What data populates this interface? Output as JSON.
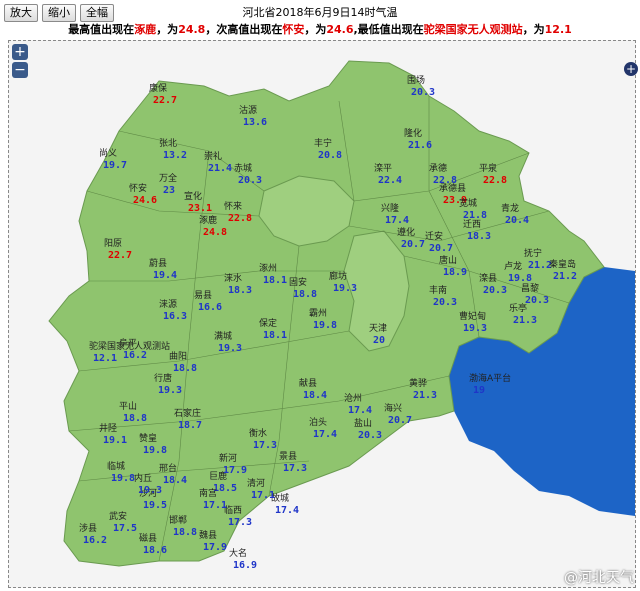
{
  "toolbar": {
    "zoom_in_label": "放大",
    "zoom_out_label": "缩小",
    "full_label": "全幅"
  },
  "title": "河北省2018年6月9日14时气温",
  "subtitle": {
    "p1": "最高值出现在",
    "max_site": "涿鹿",
    "p2": "，为",
    "max_val": "24.8",
    "p3": "，次高值出现在",
    "second_site": "怀安",
    "p4": "，为",
    "second_val": "24.6",
    "p5": ",最低值出现在",
    "min_site": "驼梁国家无人观测站",
    "p6": "，为",
    "min_val": "12.1"
  },
  "map_controls": {
    "zoom_in": "+",
    "zoom_out": "−",
    "side": "+"
  },
  "watermark": "@河北天气",
  "colors": {
    "land": "#8fc46e",
    "sea": "#1d64c6",
    "outside": "#f4f4f4",
    "value": "#1f35c8",
    "hot": "#e00000"
  },
  "stations": [
    {
      "name": "康保",
      "value": "22.7",
      "hot": true
    },
    {
      "name": "沽源",
      "value": "13.6"
    },
    {
      "name": "尚义",
      "value": "19.7"
    },
    {
      "name": "张北",
      "value": "13.2"
    },
    {
      "name": "崇礼",
      "value": "21.4"
    },
    {
      "name": "赤城",
      "value": "20.3"
    },
    {
      "name": "万全",
      "value": "23"
    },
    {
      "name": "宣化",
      "value": "23.1",
      "hot": true
    },
    {
      "name": "怀安",
      "value": "24.6",
      "hot": true
    },
    {
      "name": "涿鹿",
      "value": "24.8",
      "hot": true
    },
    {
      "name": "怀来",
      "value": "22.8",
      "hot": true
    },
    {
      "name": "阳原",
      "value": "22.7",
      "hot": true
    },
    {
      "name": "蔚县",
      "value": "19.4"
    },
    {
      "name": "丰宁",
      "value": "20.8"
    },
    {
      "name": "隆化",
      "value": "21.6"
    },
    {
      "name": "围场",
      "value": "20.3"
    },
    {
      "name": "滦平",
      "value": "22.4"
    },
    {
      "name": "承德",
      "value": "22.8"
    },
    {
      "name": "承德县",
      "value": "23.9",
      "hot": true
    },
    {
      "name": "平泉",
      "value": "22.8",
      "hot": true
    },
    {
      "name": "宽城",
      "value": "21.8"
    },
    {
      "name": "兴隆",
      "value": "17.4"
    },
    {
      "name": "青龙",
      "value": "20.4"
    },
    {
      "name": "迁西",
      "value": "18.3"
    },
    {
      "name": "迁安",
      "value": "20.7"
    },
    {
      "name": "遵化",
      "value": "20.7"
    },
    {
      "name": "抚宁",
      "value": "21.2"
    },
    {
      "name": "秦皇岛",
      "value": "21.2"
    },
    {
      "name": "卢龙",
      "value": "19.8"
    },
    {
      "name": "昌黎",
      "value": "20.3"
    },
    {
      "name": "乐亭",
      "value": "21.3"
    },
    {
      "name": "滦县",
      "value": "20.3"
    },
    {
      "name": "唐山",
      "value": "18.9"
    },
    {
      "name": "丰南",
      "value": "20.3"
    },
    {
      "name": "曹妃甸",
      "value": "19.3"
    },
    {
      "name": "黄骅",
      "value": "21.3"
    },
    {
      "name": "涞源",
      "value": "16.3"
    },
    {
      "name": "易县",
      "value": "16.6"
    },
    {
      "name": "涞水",
      "value": "18.3"
    },
    {
      "name": "涿州",
      "value": "18.1"
    },
    {
      "name": "固安",
      "value": "18.8"
    },
    {
      "name": "廊坊",
      "value": "19.3"
    },
    {
      "name": "霸州",
      "value": "19.8"
    },
    {
      "name": "天津",
      "value": "20"
    },
    {
      "name": "阜平",
      "value": "16.2"
    },
    {
      "name": "曲阳",
      "value": "18.8"
    },
    {
      "name": "保定",
      "value": "18.1"
    },
    {
      "name": "满城",
      "value": "19.3"
    },
    {
      "name": "行唐",
      "value": "19.3"
    },
    {
      "name": "平山",
      "value": "18.8"
    },
    {
      "name": "石家庄",
      "value": "18.7"
    },
    {
      "name": "沧州",
      "value": "17.4"
    },
    {
      "name": "泊头",
      "value": "17.4"
    },
    {
      "name": "献县",
      "value": "18.4"
    },
    {
      "name": "海兴",
      "value": "20.7"
    },
    {
      "name": "盐山",
      "value": "20.3"
    },
    {
      "name": "渤海A平台",
      "value": "19"
    },
    {
      "name": "衡水",
      "value": "17.3"
    },
    {
      "name": "景县",
      "value": "17.3"
    },
    {
      "name": "故城",
      "value": "17.4"
    },
    {
      "name": "邢台",
      "value": "18.4"
    },
    {
      "name": "巨鹿",
      "value": "18.5"
    },
    {
      "name": "临西",
      "value": "17.3"
    },
    {
      "name": "清河",
      "value": "17.1"
    },
    {
      "name": "邯郸",
      "value": "18.8"
    },
    {
      "name": "武安",
      "value": "17.5"
    },
    {
      "name": "涉县",
      "value": "16.2"
    },
    {
      "name": "磁县",
      "value": "18.6"
    },
    {
      "name": "魏县",
      "value": "17.9"
    },
    {
      "name": "大名",
      "value": "16.9"
    },
    {
      "name": "沙河",
      "value": "19.5"
    },
    {
      "name": "临城",
      "value": "19.8"
    },
    {
      "name": "内丘",
      "value": "19.3"
    },
    {
      "name": "赞皇",
      "value": "19.8"
    },
    {
      "name": "井陉",
      "value": "19.1"
    },
    {
      "name": "新河",
      "value": "17.9"
    },
    {
      "name": "南宫",
      "value": "17.1"
    },
    {
      "name": "驼梁国家无人观测站",
      "value": "12.1"
    }
  ]
}
